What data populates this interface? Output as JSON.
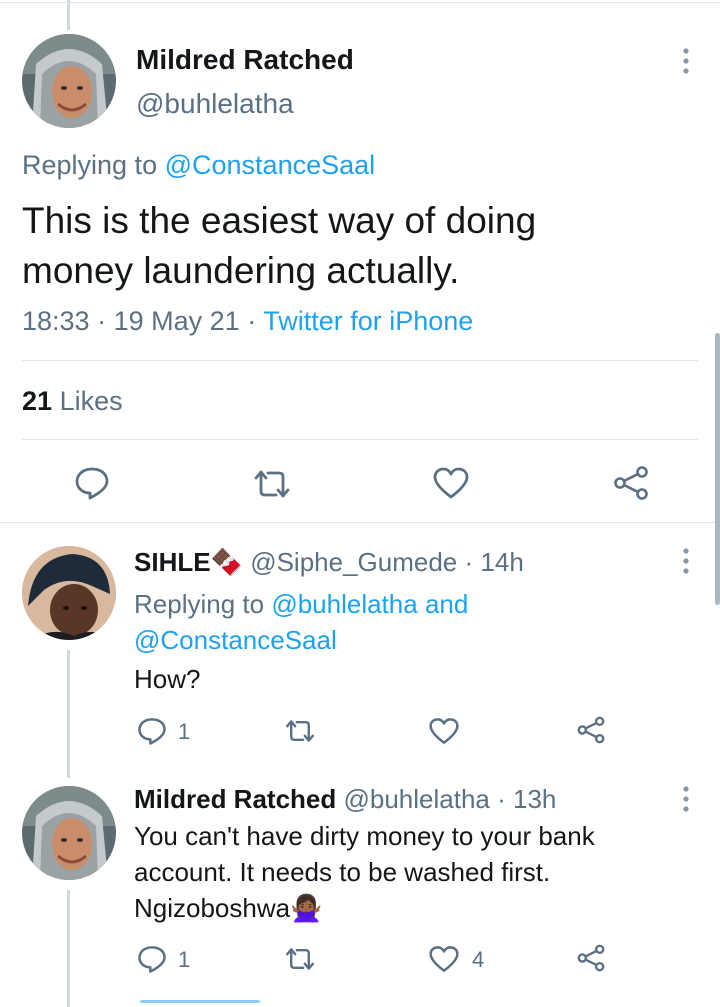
{
  "main_tweet": {
    "author_name": "Mildred Ratched",
    "author_handle": "@buhlelatha",
    "replying_prefix": "Replying to",
    "replying_to": "@ConstanceSaal",
    "text_line1": "This is the easiest way of doing",
    "text_line2": "money laundering actually.",
    "time": "18:33",
    "date": "19 May 21",
    "source": "Twitter for iPhone",
    "likes_count": "21",
    "likes_label": "Likes"
  },
  "replies": [
    {
      "author_name": "SIHLE",
      "author_emoji": "🍫",
      "author_handle": "@Siphe_Gumede",
      "age": "14h",
      "replying_prefix": "Replying to",
      "replying_to_1": "@buhlelatha",
      "replying_and": "and",
      "replying_to_2": "@ConstanceSaal",
      "text": "How?",
      "reply_count": "1",
      "like_count": ""
    },
    {
      "author_name": "Mildred Ratched",
      "author_handle": "@buhlelatha",
      "age": "13h",
      "text_line1": "You can't have dirty money to your bank",
      "text_line2": "account. It needs to be washed first.",
      "text_line3": "Ngizoboshwa",
      "text_emoji": "🙅🏾‍♀️",
      "reply_count": "1",
      "like_count": "4"
    }
  ],
  "dot_sep": "·",
  "icons": [
    "more-vertical-icon",
    "reply-icon",
    "retweet-icon",
    "like-icon",
    "share-icon"
  ],
  "colors": {
    "link": "#1da1f2",
    "secondary": "#5b7083",
    "divider": "#dfe5e9"
  }
}
